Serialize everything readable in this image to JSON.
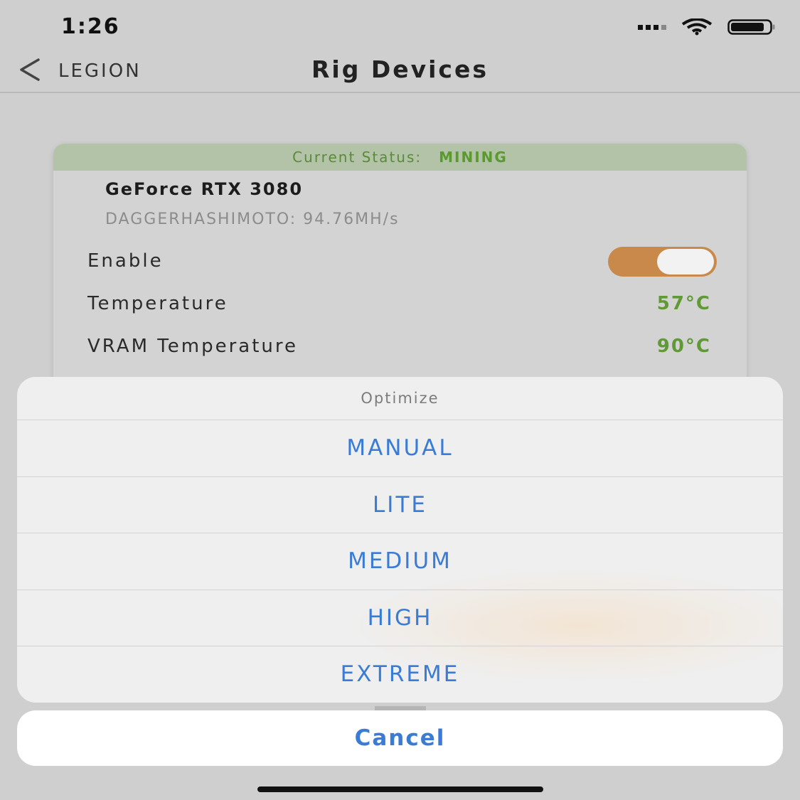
{
  "status_bar": {
    "time": "1:26",
    "icons": [
      "cellular-signal-icon",
      "wifi-icon",
      "battery-icon"
    ]
  },
  "nav": {
    "back_label": "LEGION",
    "back_icon": "chevron-left-icon",
    "title": "Rig Devices"
  },
  "device": {
    "status_label": "Current Status:",
    "status_value": "MINING",
    "name": "GeForce RTX 3080",
    "algorithm": "DAGGERHASHIMOTO: 94.76MH/s",
    "enable_label": "Enable",
    "enabled": true,
    "temperature_label": "Temperature",
    "temperature_value": "57°C",
    "vram_label": "VRAM Temperature",
    "vram_value": "90°C"
  },
  "action_sheet": {
    "title": "Optimize",
    "options": [
      "MANUAL",
      "LITE",
      "MEDIUM",
      "HIGH",
      "EXTREME"
    ],
    "cancel_label": "Cancel"
  },
  "colors": {
    "accent_blue": "#3a7bd5",
    "status_green": "#5f9a34",
    "toggle_orange": "#c8894a",
    "status_strip": "#b3c3a8"
  }
}
